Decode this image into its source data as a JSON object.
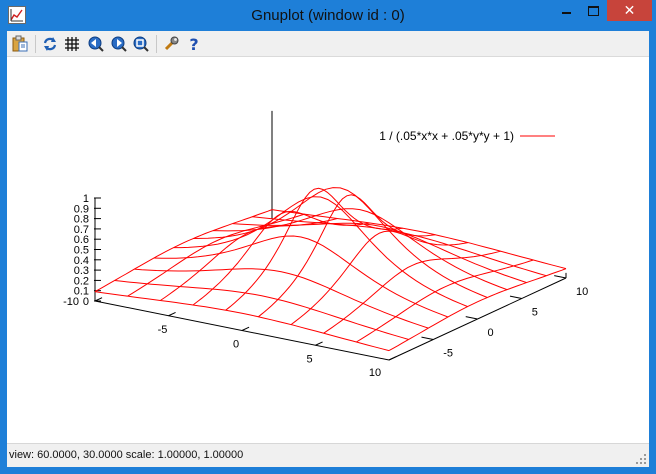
{
  "window": {
    "title": "Gnuplot (window id : 0)",
    "close_glyph": "✕"
  },
  "toolbar": {
    "icons": [
      "copy-to-clipboard-icon",
      "replot-icon",
      "grid-icon",
      "zoom-previous-icon",
      "zoom-next-icon",
      "unzoom-icon",
      "options-icon",
      "help-icon"
    ]
  },
  "status": {
    "text": "view:  60.0000,  30.0000   scale:  1.00000,  1.00000"
  },
  "colors": {
    "surface": "#ff0000",
    "axes": "#000000",
    "titlebar": "#1e7fd8"
  },
  "chart_data": {
    "type": "surface",
    "legend": "1 / (.05*x*x + .05*y*y + 1)",
    "legend_position": "top-right",
    "view": [
      60,
      30
    ],
    "scale": [
      1,
      1
    ],
    "x_range": [
      -10,
      10
    ],
    "y_range": [
      -10,
      10
    ],
    "z_range": [
      0,
      1
    ],
    "x_ticks": [
      "-10",
      "-5",
      "0",
      "5",
      "10"
    ],
    "y_ticks": [
      "-5",
      "0",
      "5",
      "10"
    ],
    "z_ticks": [
      "0",
      "0.1",
      "0.2",
      "0.3",
      "0.4",
      "0.5",
      "0.6",
      "0.7",
      "0.8",
      "0.9",
      "1"
    ],
    "grid_samples": 10,
    "x": [
      -10,
      -7.7778,
      -5.5556,
      -3.3333,
      -1.1111,
      1.1111,
      3.3333,
      5.5556,
      7.7778,
      10
    ],
    "y": [
      -10,
      -7.7778,
      -5.5556,
      -3.3333,
      -1.1111,
      1.1111,
      3.3333,
      5.5556,
      7.7778,
      10
    ]
  }
}
